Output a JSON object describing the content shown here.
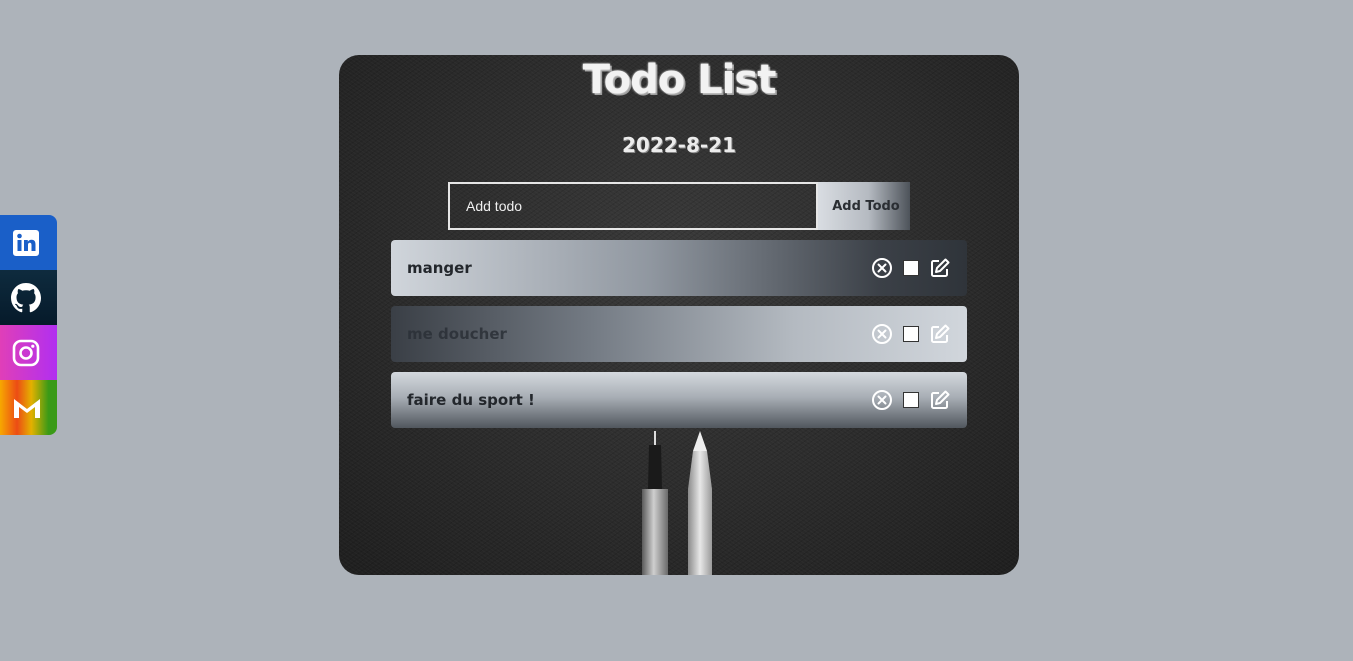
{
  "social": {
    "items": [
      {
        "name": "linkedin",
        "icon": "linkedin-icon"
      },
      {
        "name": "github",
        "icon": "github-icon"
      },
      {
        "name": "instagram",
        "icon": "instagram-icon"
      },
      {
        "name": "gmail",
        "icon": "gmail-icon"
      }
    ]
  },
  "app": {
    "title": "Todo List",
    "date": "2022-8-21"
  },
  "form": {
    "placeholder": "Add todo",
    "value": "",
    "button_label": "Add Todo"
  },
  "todos": [
    {
      "text": "manger",
      "checked": false
    },
    {
      "text": "me doucher",
      "checked": false
    },
    {
      "text": "faire du sport !",
      "checked": false
    }
  ],
  "colors": {
    "page_background": "#adb3ba",
    "card_background": "#2c2c2c",
    "linkedin": "#1a5fc8",
    "github": "#0e2b3e",
    "instagram": "#c535d8"
  },
  "icons": {
    "delete": "circle-x-icon",
    "complete": "checkbox",
    "edit": "edit-icon"
  }
}
